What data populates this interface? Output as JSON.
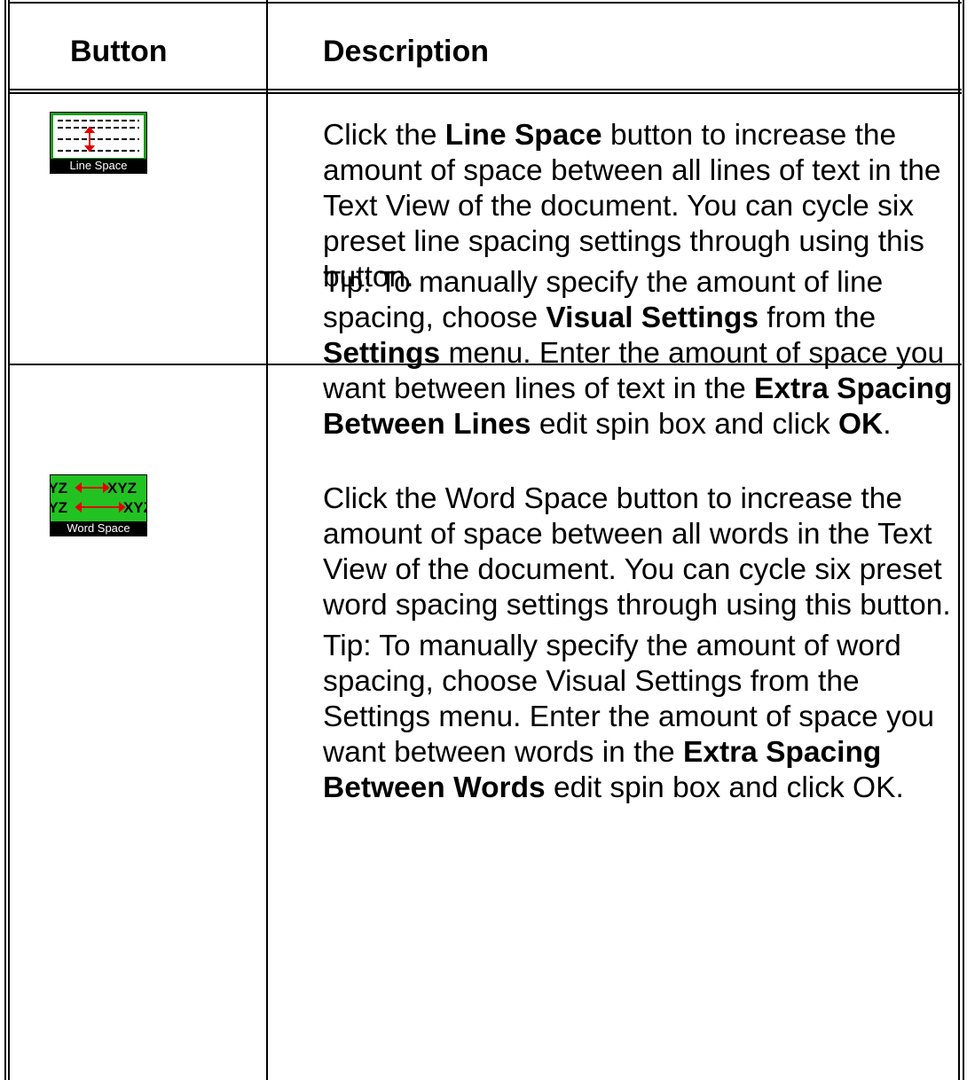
{
  "table": {
    "header": {
      "button": "Button",
      "description": "Description"
    },
    "rows": [
      {
        "icon": {
          "name": "line-space-icon",
          "label": "Line Space",
          "background": "#1a9c1a",
          "arrow_color": "#e00000"
        },
        "paragraphs": [
          {
            "segments": [
              {
                "text": "Click the ",
                "bold": false
              },
              {
                "text": "Line Space",
                "bold": true
              },
              {
                "text": " button to increase the amount of space between all lines of text in the Text View of the document. You can cycle six preset line spacing settings through using this button.",
                "bold": false
              }
            ]
          },
          {
            "segments": [
              {
                "text": "Tip: To manually specify the amount of line spacing, choose ",
                "bold": false
              },
              {
                "text": "Visual Settings",
                "bold": true
              },
              {
                "text": " from the ",
                "bold": false
              },
              {
                "text": "Settings",
                "bold": true
              },
              {
                "text": " menu. Enter the amount of space you want between lines of text in the ",
                "bold": false
              },
              {
                "text": "Extra Spacing Between Lines",
                "bold": true
              },
              {
                "text": " edit spin box and click ",
                "bold": false
              },
              {
                "text": "OK",
                "bold": true
              },
              {
                "text": ".",
                "bold": false
              }
            ]
          }
        ]
      },
      {
        "icon": {
          "name": "word-space-icon",
          "label": "Word Space",
          "letters": "XYZ",
          "background": "#23c223",
          "arrow_color": "#e00000"
        },
        "paragraphs": [
          {
            "segments": [
              {
                "text": "Click the Word Space button to increase the amount of space between all words in the Text View of the document. You can cycle six preset word spacing settings through using this button.",
                "bold": false
              }
            ]
          },
          {
            "segments": [
              {
                "text": "Tip: To manually specify the amount of word spacing, choose Visual Settings from the Settings menu. Enter the amount of space you want between words in the ",
                "bold": false
              },
              {
                "text": "Extra Spacing Between Words",
                "bold": true
              },
              {
                "text": " edit spin box and click OK.",
                "bold": false
              }
            ]
          }
        ]
      }
    ]
  }
}
